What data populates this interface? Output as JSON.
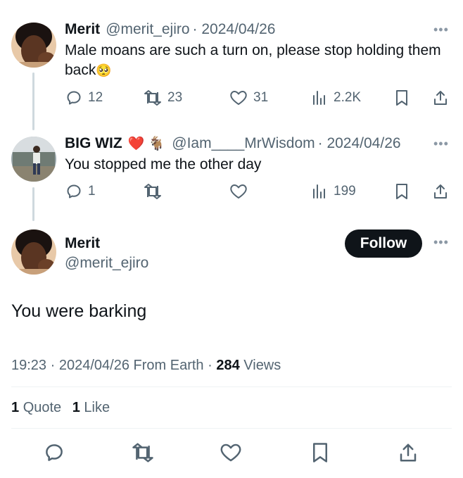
{
  "tweet1": {
    "name": "Merit",
    "handle": "@merit_ejiro",
    "date": "· 2024/04/26",
    "text": "Male moans are such a turn on, please stop holding them back",
    "emoji": "🥺",
    "replies": "12",
    "retweets": "23",
    "likes": "31",
    "views": "2.2K"
  },
  "tweet2": {
    "name": "BIG WIZ",
    "name_emojis": "❤️ 🐐",
    "handle": "@Iam____MrWisdom",
    "date": "· 2024/04/26",
    "text": "You stopped me the other day",
    "replies": "1",
    "views": "199"
  },
  "main_tweet": {
    "name": "Merit",
    "handle": "@merit_ejiro",
    "follow_label": "Follow",
    "text": "You were barking",
    "time": "19:23",
    "date": "2024/04/26",
    "source": "From Earth",
    "views_count": "284",
    "views_label": "Views",
    "quotes_count": "1",
    "quotes_label": "Quote",
    "likes_count": "1",
    "likes_label": "Like"
  },
  "colors": {
    "text": "#0f1419",
    "secondary": "#536471",
    "heart": "#f91880",
    "button": "#0f1419"
  }
}
